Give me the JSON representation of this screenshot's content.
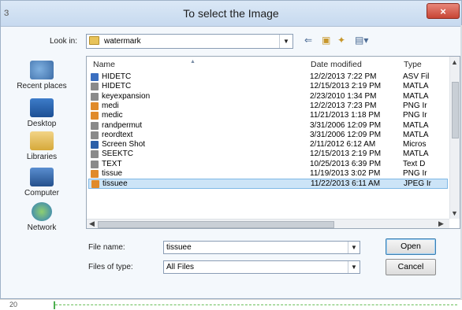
{
  "dialog": {
    "title": "To select the Image",
    "close_label": "×"
  },
  "look_in": {
    "label": "Look in:",
    "value": "watermark"
  },
  "toolbar_icons": [
    "back-arrow-icon",
    "up-folder-icon",
    "new-folder-icon",
    "view-menu-icon"
  ],
  "places": [
    {
      "label": "Recent places",
      "icon": "recent-places-icon"
    },
    {
      "label": "Desktop",
      "icon": "desktop-icon"
    },
    {
      "label": "Libraries",
      "icon": "libraries-icon"
    },
    {
      "label": "Computer",
      "icon": "computer-icon"
    },
    {
      "label": "Network",
      "icon": "network-icon"
    }
  ],
  "columns": {
    "name": "Name",
    "date": "Date modified",
    "type": "Type"
  },
  "files": [
    {
      "name": "HIDETC",
      "date": "12/2/2013 7:22 PM",
      "type": "ASV Fil",
      "icon": "asv-file-icon",
      "color": "#3a6fc0"
    },
    {
      "name": "HIDETC",
      "date": "12/15/2013 2:19 PM",
      "type": "MATLA",
      "icon": "matlab-file-icon",
      "color": "#8a8a8a"
    },
    {
      "name": "keyexpansion",
      "date": "2/23/2010 1:34 PM",
      "type": "MATLA",
      "icon": "matlab-file-icon",
      "color": "#8a8a8a"
    },
    {
      "name": "medi",
      "date": "12/2/2013 7:23 PM",
      "type": "PNG Ir",
      "icon": "image-file-icon",
      "color": "#e08a2a"
    },
    {
      "name": "medic",
      "date": "11/21/2013 1:18 PM",
      "type": "PNG Ir",
      "icon": "image-file-icon",
      "color": "#e08a2a"
    },
    {
      "name": "randpermut",
      "date": "3/31/2006 12:09 PM",
      "type": "MATLA",
      "icon": "matlab-file-icon",
      "color": "#8a8a8a"
    },
    {
      "name": "reordtext",
      "date": "3/31/2006 12:09 PM",
      "type": "MATLA",
      "icon": "matlab-file-icon",
      "color": "#8a8a8a"
    },
    {
      "name": "Screen Shot",
      "date": "2/11/2012 6:12 AM",
      "type": "Micros",
      "icon": "word-file-icon",
      "color": "#2b5fa8"
    },
    {
      "name": "SEEKTC",
      "date": "12/15/2013 2:19 PM",
      "type": "MATLA",
      "icon": "matlab-file-icon",
      "color": "#8a8a8a"
    },
    {
      "name": "TEXT",
      "date": "10/25/2013 6:39 PM",
      "type": "Text D",
      "icon": "text-file-icon",
      "color": "#8a8a8a"
    },
    {
      "name": "tissue",
      "date": "11/19/2013 3:02 PM",
      "type": "PNG Ir",
      "icon": "image-file-icon",
      "color": "#e08a2a"
    },
    {
      "name": "tissuee",
      "date": "11/22/2013 6:11 AM",
      "type": "JPEG Ir",
      "icon": "image-file-icon",
      "color": "#e08a2a",
      "selected": true
    }
  ],
  "file_name": {
    "label": "File name:",
    "value": "tissuee"
  },
  "files_of_type": {
    "label": "Files of type:",
    "value": "All Files"
  },
  "buttons": {
    "open": "Open",
    "cancel": "Cancel"
  },
  "background": {
    "line_number": "20"
  },
  "colors": {
    "selection": "#cce4f7",
    "title_gradient_top": "#dbe8f6",
    "close_red": "#c74535"
  }
}
